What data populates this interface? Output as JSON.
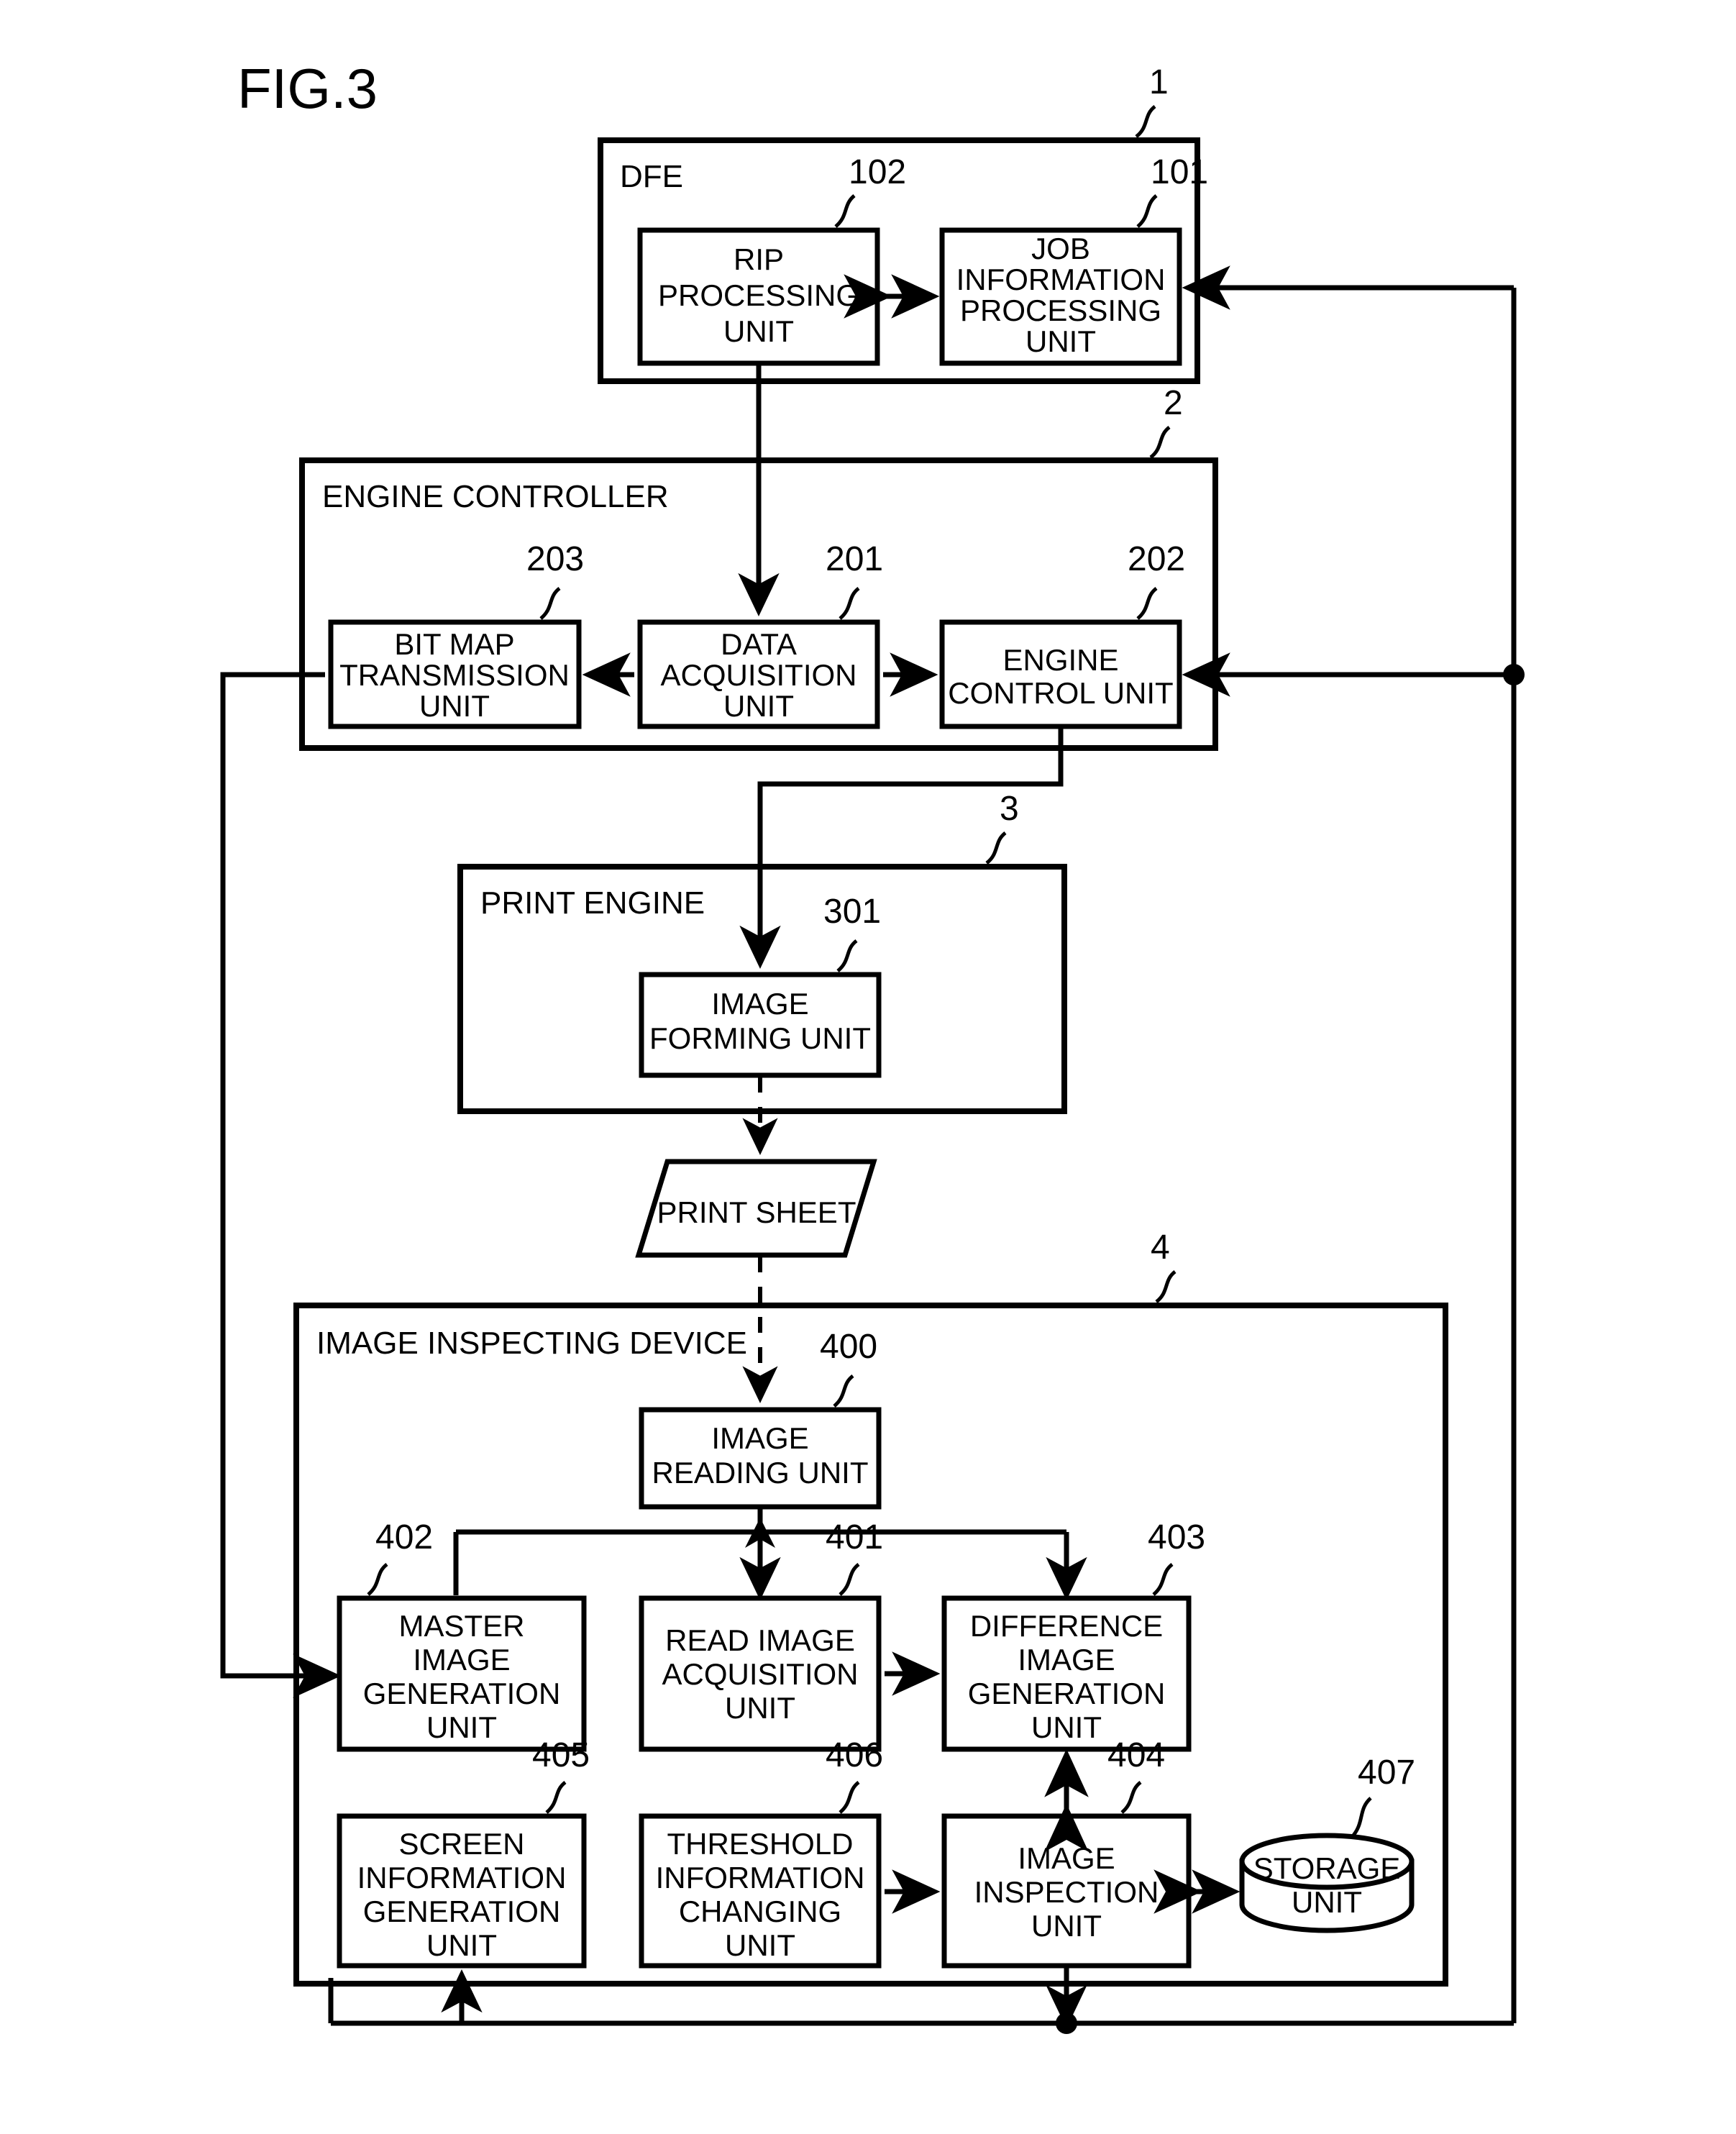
{
  "figure": {
    "title": "FIG.3"
  },
  "containers": {
    "dfe": {
      "label": "DFE",
      "ref": "1"
    },
    "engine_controller": {
      "label": "ENGINE CONTROLLER",
      "ref": "2"
    },
    "print_engine": {
      "label": "PRINT ENGINE",
      "ref": "3"
    },
    "image_inspecting_device": {
      "label": "IMAGE INSPECTING DEVICE",
      "ref": "4"
    }
  },
  "blocks": {
    "rip_processing_unit": {
      "ref": "102",
      "line1": "RIP",
      "line2": "PROCESSING",
      "line3": "UNIT"
    },
    "job_information_processing_unit": {
      "ref": "101",
      "line1": "JOB",
      "line2": "INFORMATION",
      "line3": "PROCESSING",
      "line4": "UNIT"
    },
    "bit_map_transmission_unit": {
      "ref": "203",
      "line1": "BIT MAP",
      "line2": "TRANSMISSION",
      "line3": "UNIT"
    },
    "data_acquisition_unit": {
      "ref": "201",
      "line1": "DATA",
      "line2": "ACQUISITION",
      "line3": "UNIT"
    },
    "engine_control_unit": {
      "ref": "202",
      "line1": "ENGINE",
      "line2": "CONTROL UNIT"
    },
    "image_forming_unit": {
      "ref": "301",
      "line1": "IMAGE",
      "line2": "FORMING UNIT"
    },
    "print_sheet": {
      "ref": "",
      "line1": "PRINT SHEET"
    },
    "image_reading_unit": {
      "ref": "400",
      "line1": "IMAGE",
      "line2": "READING UNIT"
    },
    "master_image_generation_unit": {
      "ref": "402",
      "line1": "MASTER",
      "line2": "IMAGE",
      "line3": "GENERATION",
      "line4": "UNIT"
    },
    "read_image_acquisition_unit": {
      "ref": "401",
      "line1": "READ IMAGE",
      "line2": "ACQUISITION",
      "line3": "UNIT"
    },
    "difference_image_generation_unit": {
      "ref": "403",
      "line1": "DIFFERENCE",
      "line2": "IMAGE",
      "line3": "GENERATION",
      "line4": "UNIT"
    },
    "screen_information_generation_unit": {
      "ref": "405",
      "line1": "SCREEN",
      "line2": "INFORMATION",
      "line3": "GENERATION",
      "line4": "UNIT"
    },
    "threshold_information_changing_unit": {
      "ref": "406",
      "line1": "THRESHOLD",
      "line2": "INFORMATION",
      "line3": "CHANGING",
      "line4": "UNIT"
    },
    "image_inspection_unit": {
      "ref": "404",
      "line1": "IMAGE",
      "line2": "INSPECTION",
      "line3": "UNIT"
    },
    "storage_unit": {
      "ref": "407",
      "line1": "STORAGE",
      "line2": "UNIT"
    }
  },
  "colors": {
    "stroke": "#000000",
    "background": "#ffffff"
  }
}
